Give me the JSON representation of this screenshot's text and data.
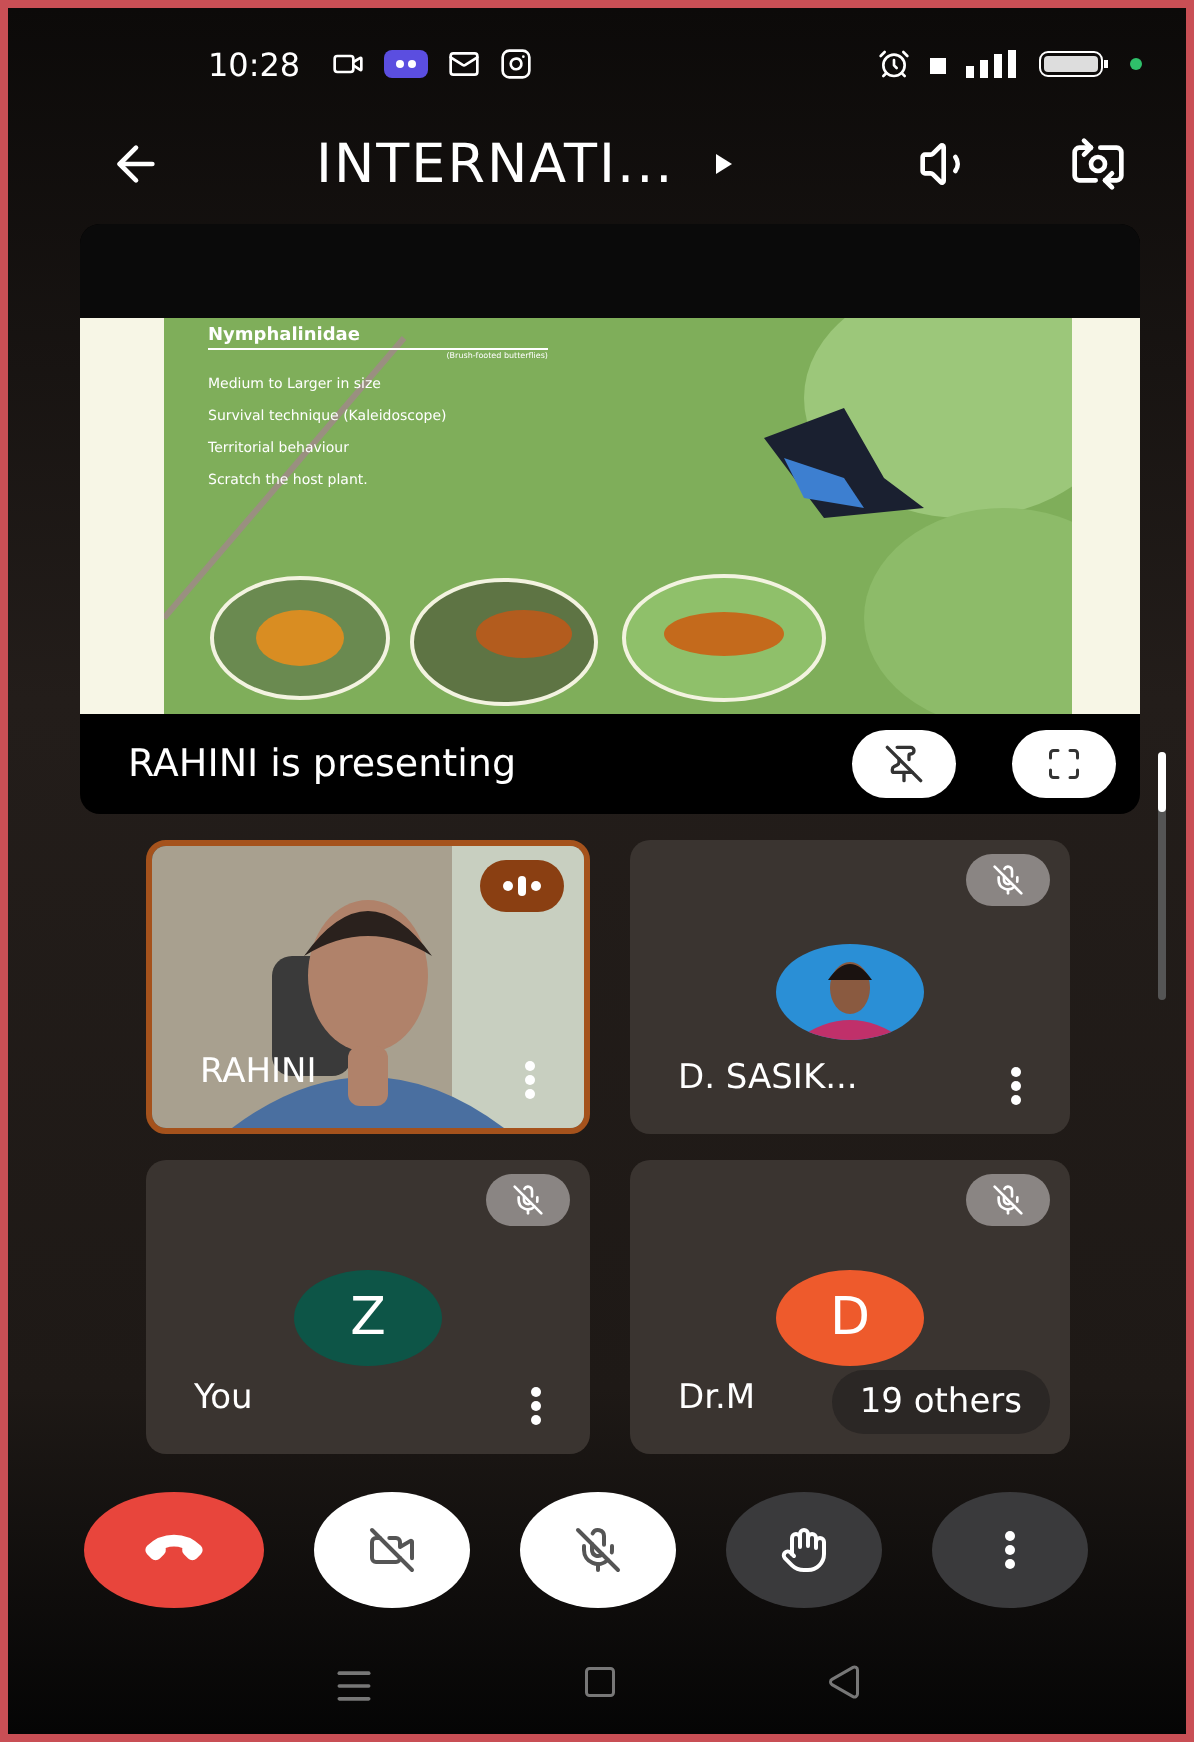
{
  "status_bar": {
    "time": "10:28"
  },
  "header": {
    "title": "INTERNATI..."
  },
  "presentation": {
    "slide": {
      "heading": "Nymphalinidae",
      "subheading": "(Brush-footed butterflies)",
      "points": [
        "Medium to Larger in size",
        "Survival technique (Kaleidoscope)",
        "Territorial behaviour",
        "Scratch the host plant."
      ]
    },
    "caption": "RAHINI is presenting",
    "pinned": false
  },
  "participants": [
    {
      "name": "RAHINI",
      "kind": "video",
      "muted": false,
      "speaking": true
    },
    {
      "name": "D. SASIK...",
      "muted": true,
      "speaking": false
    },
    {
      "name": "You",
      "kind": "initial",
      "initial": "Z",
      "color": "#0d5547",
      "muted": true,
      "speaking": false
    },
    {
      "name": "Dr.M",
      "kind": "initial",
      "initial": "D",
      "color": "#ee5a2c",
      "muted": true,
      "speaking": false,
      "overlay": "19 others"
    }
  ],
  "controls": [
    {
      "kind": "end"
    },
    {
      "kind": "camera",
      "on": false
    },
    {
      "kind": "mic",
      "on": false
    },
    {
      "kind": "hand",
      "on": false
    },
    {
      "kind": "more"
    }
  ]
}
